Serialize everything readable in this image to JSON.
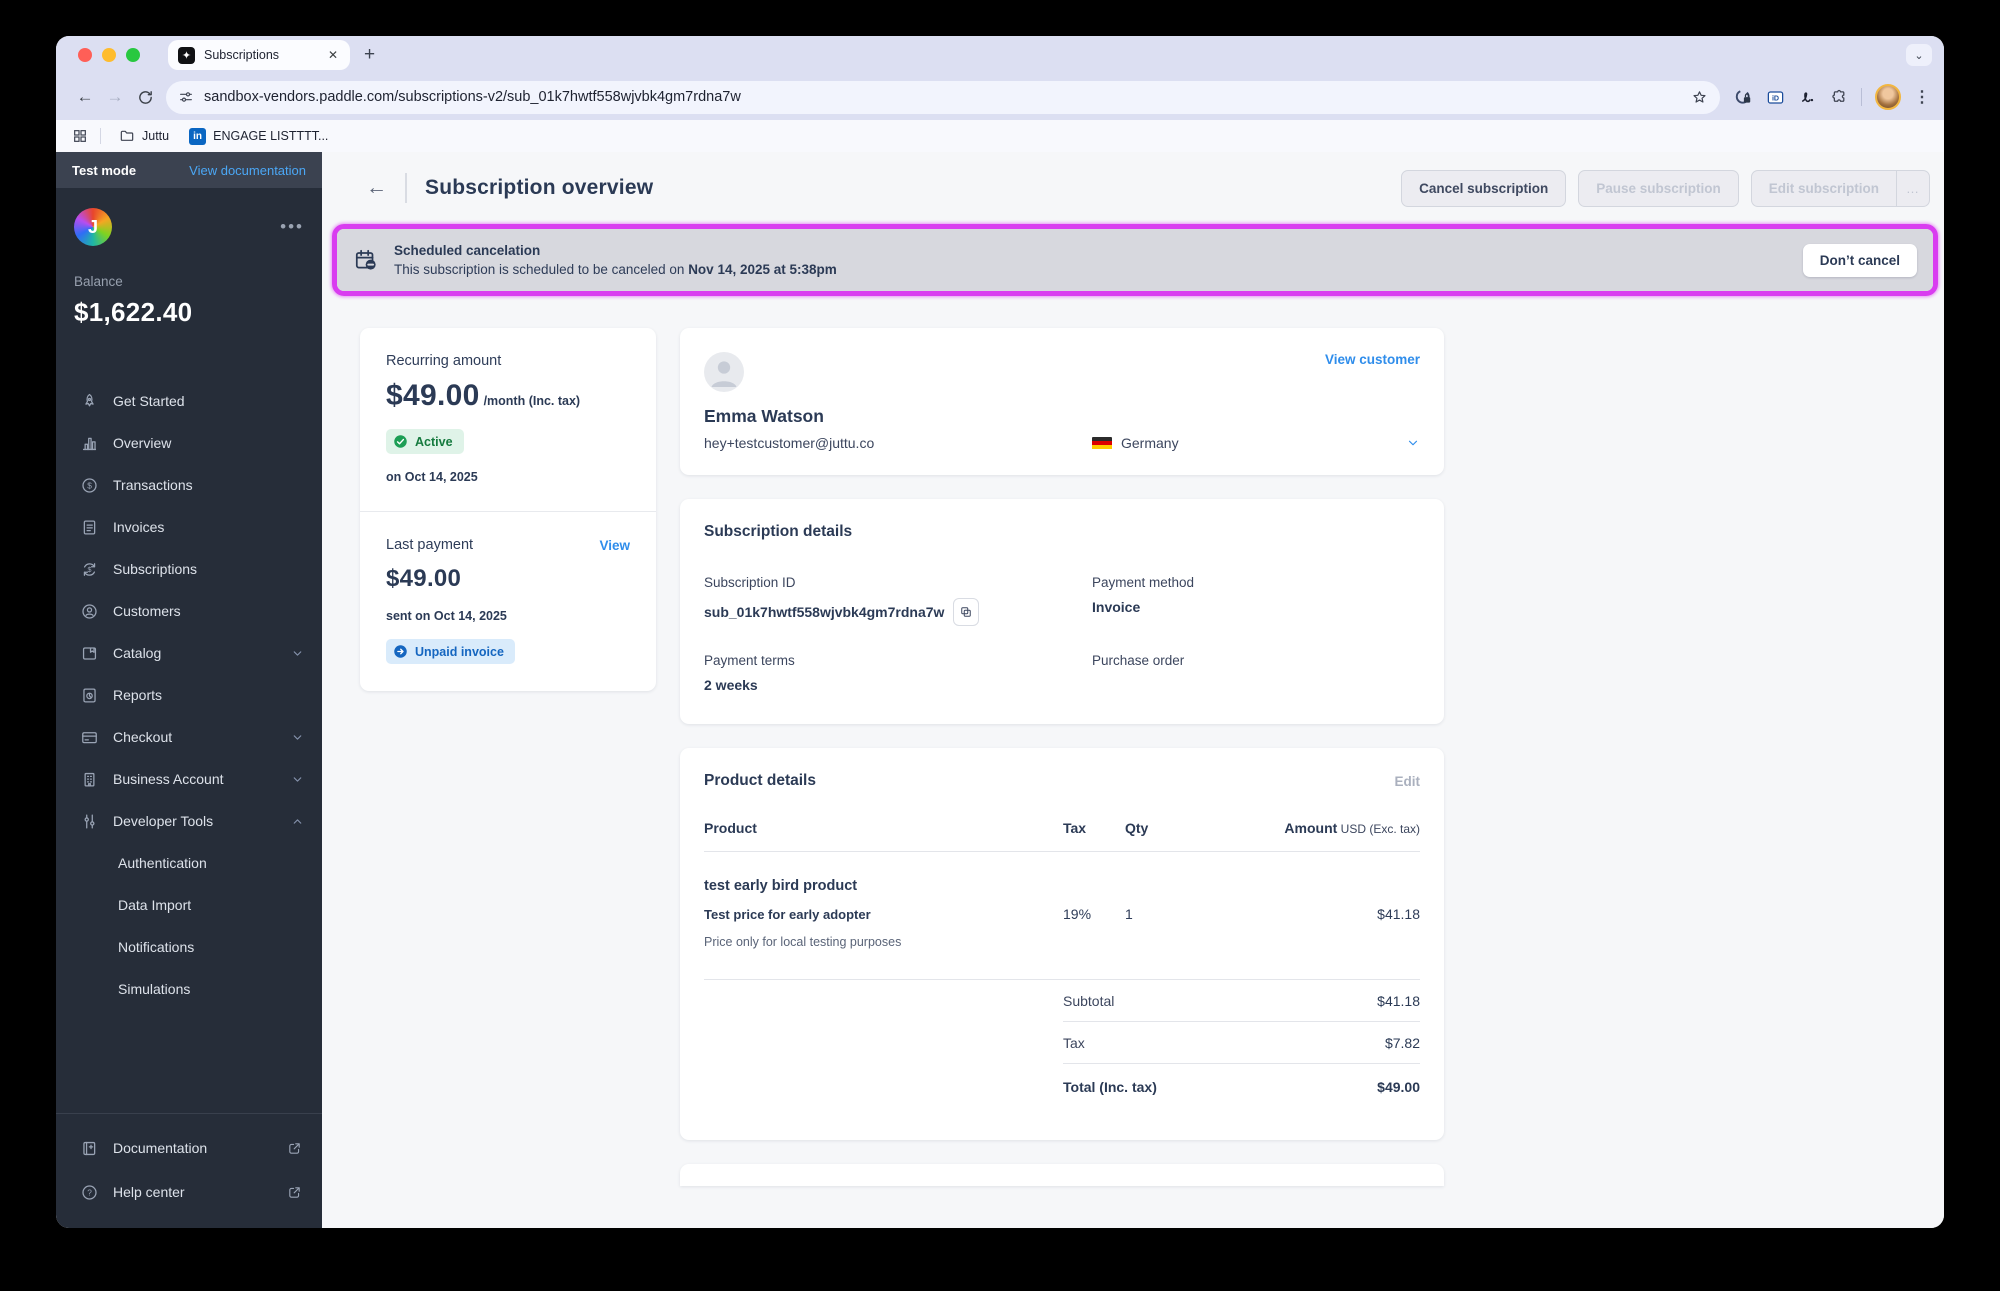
{
  "browser": {
    "tab_title": "Subscriptions",
    "url": "sandbox-vendors.paddle.com/subscriptions-v2/sub_01k7hwtf558wjvbk4gm7rdna7w",
    "favicon_glyph": "✦",
    "bookmarks": {
      "folder": "Juttu",
      "linkedin": "ENGAGE LISTTTT..."
    }
  },
  "sidebar": {
    "test_mode": "Test mode",
    "view_documentation": "View documentation",
    "avatar_letter": "J",
    "balance_label": "Balance",
    "balance_value": "$1,622.40",
    "items": [
      {
        "label": "Get Started"
      },
      {
        "label": "Overview"
      },
      {
        "label": "Transactions"
      },
      {
        "label": "Invoices"
      },
      {
        "label": "Subscriptions"
      },
      {
        "label": "Customers"
      },
      {
        "label": "Catalog"
      },
      {
        "label": "Reports"
      },
      {
        "label": "Checkout"
      },
      {
        "label": "Business Account"
      },
      {
        "label": "Developer Tools"
      }
    ],
    "sub_items": [
      "Authentication",
      "Data Import",
      "Notifications",
      "Simulations"
    ],
    "footer_items": [
      "Documentation",
      "Help center"
    ]
  },
  "header": {
    "title": "Subscription overview",
    "cancel_button": "Cancel subscription",
    "pause_button": "Pause subscription",
    "edit_button": "Edit subscription",
    "more_button": "…"
  },
  "banner": {
    "title": "Scheduled cancelation",
    "message_prefix": "This subscription is scheduled to be canceled on ",
    "message_bold": "Nov 14, 2025 at 5:38pm",
    "action": "Don’t cancel"
  },
  "recurring": {
    "label": "Recurring amount",
    "amount": "$49.00",
    "suffix": "/month (Inc. tax)",
    "status": "Active",
    "date": "on Oct 14, 2025"
  },
  "last_payment": {
    "label": "Last payment",
    "view": "View",
    "amount": "$49.00",
    "date": "sent on Oct 14, 2025",
    "badge": "Unpaid invoice"
  },
  "customer": {
    "view_link": "View customer",
    "name": "Emma Watson",
    "email": "hey+testcustomer@juttu.co",
    "country": "Germany"
  },
  "subscription_details": {
    "title": "Subscription details",
    "fields": [
      {
        "label": "Subscription ID",
        "value": "sub_01k7hwtf558wjvbk4gm7rdna7w"
      },
      {
        "label": "Payment method",
        "value": "Invoice"
      },
      {
        "label": "Payment terms",
        "value": "2 weeks"
      },
      {
        "label": "Purchase order",
        "value": ""
      }
    ]
  },
  "product_details": {
    "title": "Product details",
    "edit": "Edit",
    "columns": {
      "product": "Product",
      "tax": "Tax",
      "qty": "Qty",
      "amount": "Amount",
      "amount_note": " USD (Exc. tax)"
    },
    "rows": [
      {
        "name": "test early bird product",
        "price_name": "Test price for early adopter",
        "note": "Price only for local testing purposes",
        "tax": "19%",
        "qty": "1",
        "amount": "$41.18"
      }
    ],
    "totals": [
      {
        "label": "Subtotal",
        "value": "$41.18"
      },
      {
        "label": "Tax",
        "value": "$7.82"
      },
      {
        "label": "Total (Inc. tax)",
        "value": "$49.00"
      }
    ]
  },
  "colors": {
    "annotation_magenta": "#d93df0",
    "link_blue": "#2f8deb",
    "status_active_green": "#157a3e",
    "unpaid_badge_blue": "#1566c0",
    "sidebar_dark": "#262d39",
    "chrome_lavender": "#dcdff2"
  }
}
